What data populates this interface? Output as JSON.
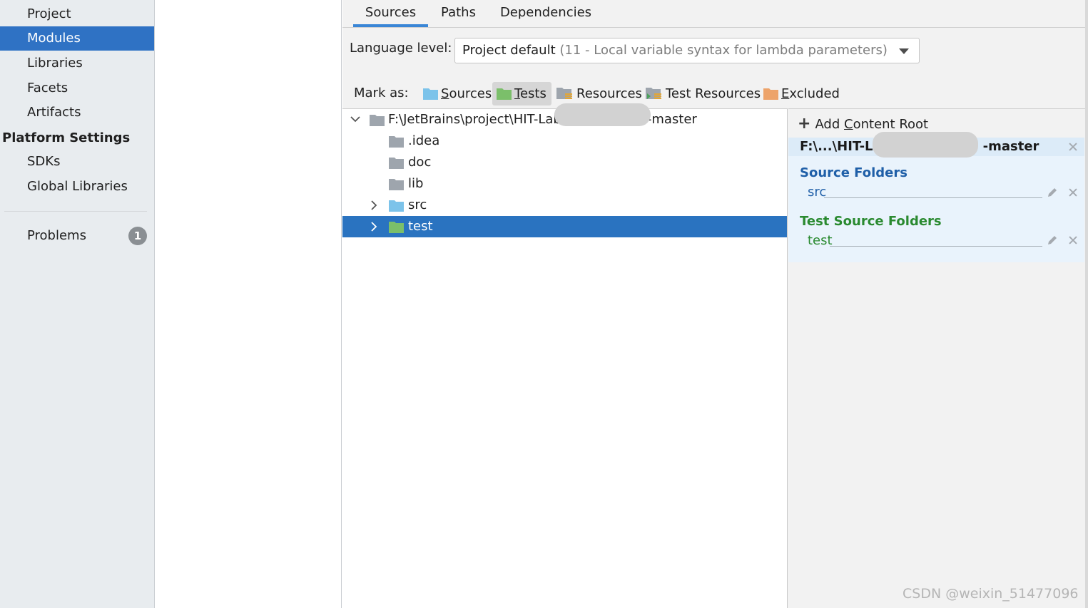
{
  "sidebar": {
    "items": [
      {
        "label": "Project"
      },
      {
        "label": "Modules"
      },
      {
        "label": "Libraries"
      },
      {
        "label": "Facets"
      },
      {
        "label": "Artifacts"
      }
    ],
    "platform_heading": "Platform Settings",
    "platform_items": [
      {
        "label": "SDKs"
      },
      {
        "label": "Global Libraries"
      }
    ],
    "problems": {
      "label": "Problems",
      "count": "1"
    }
  },
  "tabs": [
    {
      "label": "Sources"
    },
    {
      "label": "Paths"
    },
    {
      "label": "Dependencies"
    }
  ],
  "language_level": {
    "label": "Language level:",
    "value": "Project default",
    "detail": "(11 - Local variable syntax for lambda parameters)"
  },
  "mark_as": {
    "label": "Mark as:",
    "buttons": [
      {
        "label": "Sources",
        "mnemonic": "S",
        "rest": "ources",
        "icon": "source-folder-icon"
      },
      {
        "label": "Tests",
        "mnemonic": "T",
        "rest": "ests",
        "icon": "test-folder-icon"
      },
      {
        "label": "Resources",
        "icon": "resource-folder-icon"
      },
      {
        "label": "Test Resources",
        "icon": "test-resource-folder-icon"
      },
      {
        "label": "Excluded",
        "mnemonic": "E",
        "rest": "xcluded",
        "icon": "excluded-folder-icon"
      }
    ]
  },
  "tree": {
    "root": {
      "prefix": "F:\\JetBrains\\project\\HIT-Lab",
      "suffix": "-master"
    },
    "children": [
      {
        "label": ".idea",
        "icon": "folder-icon"
      },
      {
        "label": "doc",
        "icon": "folder-icon"
      },
      {
        "label": "lib",
        "icon": "folder-icon"
      },
      {
        "label": "src",
        "icon": "source-folder-icon"
      },
      {
        "label": "test",
        "icon": "test-folder-icon"
      }
    ]
  },
  "content_root": {
    "add_label_prefix": "Add ",
    "add_label_mnemonic": "C",
    "add_label_rest": "ontent Root",
    "path_prefix": "F:\\...\\HIT-La",
    "path_suffix": "-master",
    "source_heading": "Source Folders",
    "source_entries": [
      "src"
    ],
    "test_heading": "Test Source Folders",
    "test_entries": [
      "test"
    ]
  },
  "watermark": "CSDN @weixin_51477096",
  "colors": {
    "selection": "#2f72c4",
    "source_heading": "#1f5fa8",
    "test_heading": "#2a8a30",
    "source_folder": "#7cc3ea",
    "test_folder": "#7bbf6a",
    "excluded_folder": "#eda36a"
  }
}
